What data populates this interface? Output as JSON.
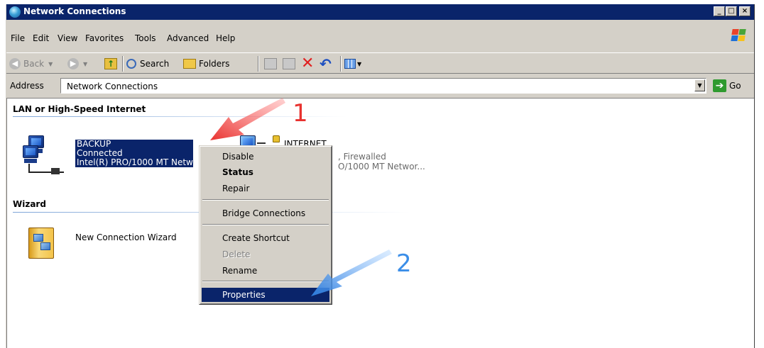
{
  "window": {
    "title": "Network Connections",
    "caption_buttons": [
      "_",
      "□",
      "×"
    ]
  },
  "menubar": {
    "items": [
      "File",
      "Edit",
      "View",
      "Favorites",
      "Tools",
      "Advanced",
      "Help"
    ]
  },
  "toolbar": {
    "back_label": "Back",
    "search_label": "Search",
    "folders_label": "Folders"
  },
  "addressbar": {
    "label": "Address",
    "value": "Network Connections",
    "go_label": "Go"
  },
  "groups": {
    "lan_header": "LAN or High-Speed Internet",
    "wizard_header": "Wizard"
  },
  "connections": [
    {
      "name": "BACKUP",
      "status": "Connected",
      "device": "Intel(R) PRO/1000 MT Netw"
    },
    {
      "name": "INTERNET",
      "status_fragment": ", Firewalled",
      "device_fragment": "O/1000 MT Networ..."
    }
  ],
  "wizard": {
    "label": "New Connection Wizard"
  },
  "context_menu": {
    "items": [
      {
        "label": "Disable"
      },
      {
        "label": "Status"
      },
      {
        "label": "Repair"
      },
      {
        "label": "Bridge Connections"
      },
      {
        "label": "Create Shortcut"
      },
      {
        "label": "Delete"
      },
      {
        "label": "Rename"
      },
      {
        "label": "Properties"
      }
    ]
  },
  "annotations": {
    "step_1": "1",
    "step_2": "2",
    "colors": {
      "step_1": "#e8322f",
      "step_2": "#3b8ee8"
    }
  }
}
